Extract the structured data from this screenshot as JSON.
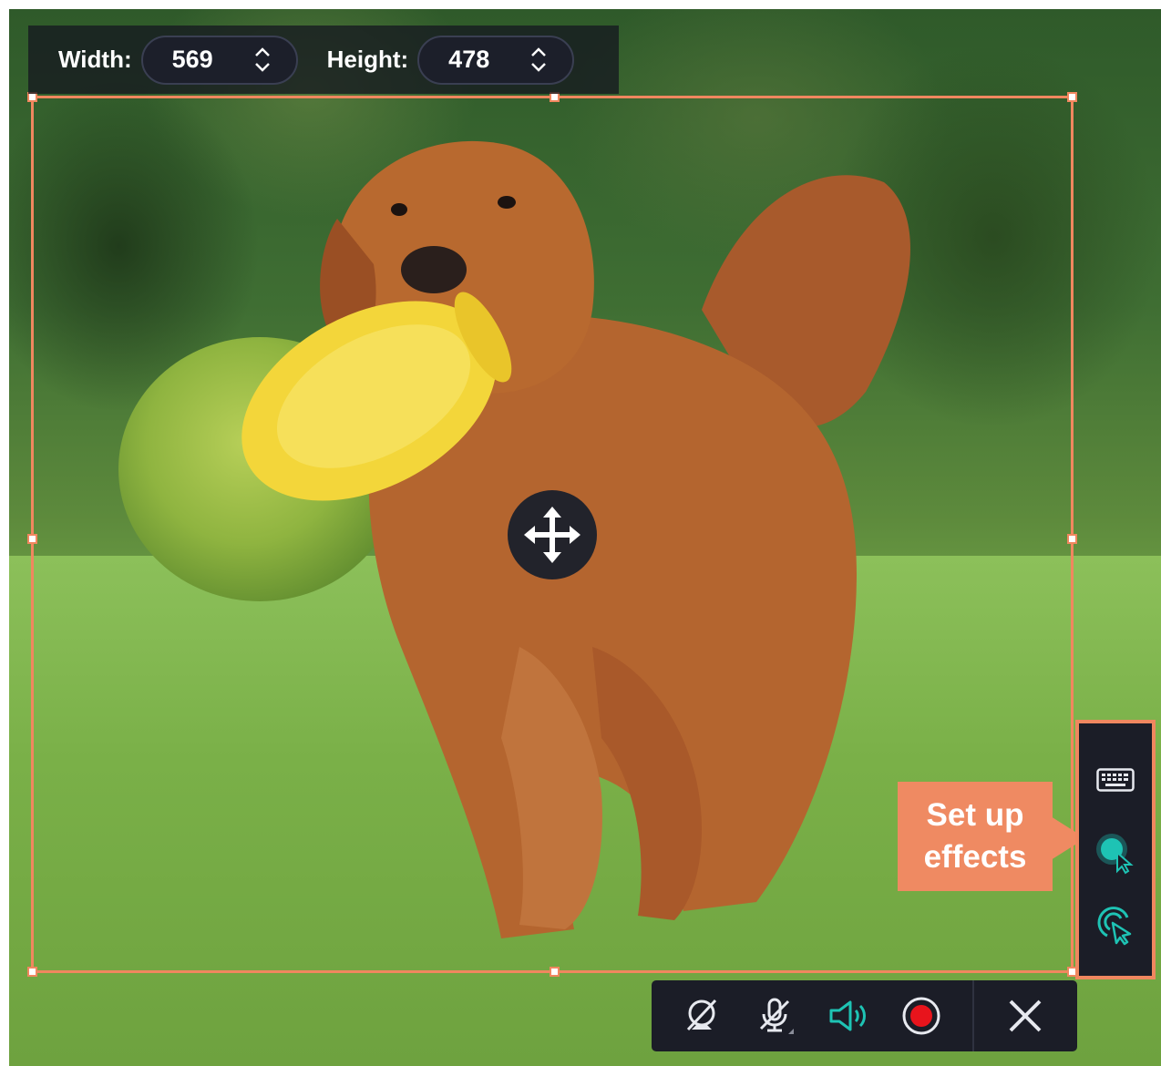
{
  "size_toolbar": {
    "width_label": "Width:",
    "width_value": "569",
    "height_label": "Height:",
    "height_value": "478"
  },
  "callout": {
    "line1": "Set up",
    "line2": "effects"
  },
  "effects_panel": {
    "items": [
      {
        "icon": "keyboard-icon"
      },
      {
        "icon": "cursor-highlight-icon"
      },
      {
        "icon": "click-effect-icon"
      }
    ]
  },
  "record_toolbar": {
    "items": [
      {
        "icon": "webcam-off-icon"
      },
      {
        "icon": "microphone-off-icon"
      },
      {
        "icon": "system-audio-icon"
      },
      {
        "icon": "record-icon"
      },
      {
        "icon": "close-icon"
      }
    ]
  },
  "colors": {
    "frame": "#f0875f",
    "accent_teal": "#1ec3b4",
    "record_red": "#e8141c",
    "panel_bg": "#1b1d27"
  }
}
